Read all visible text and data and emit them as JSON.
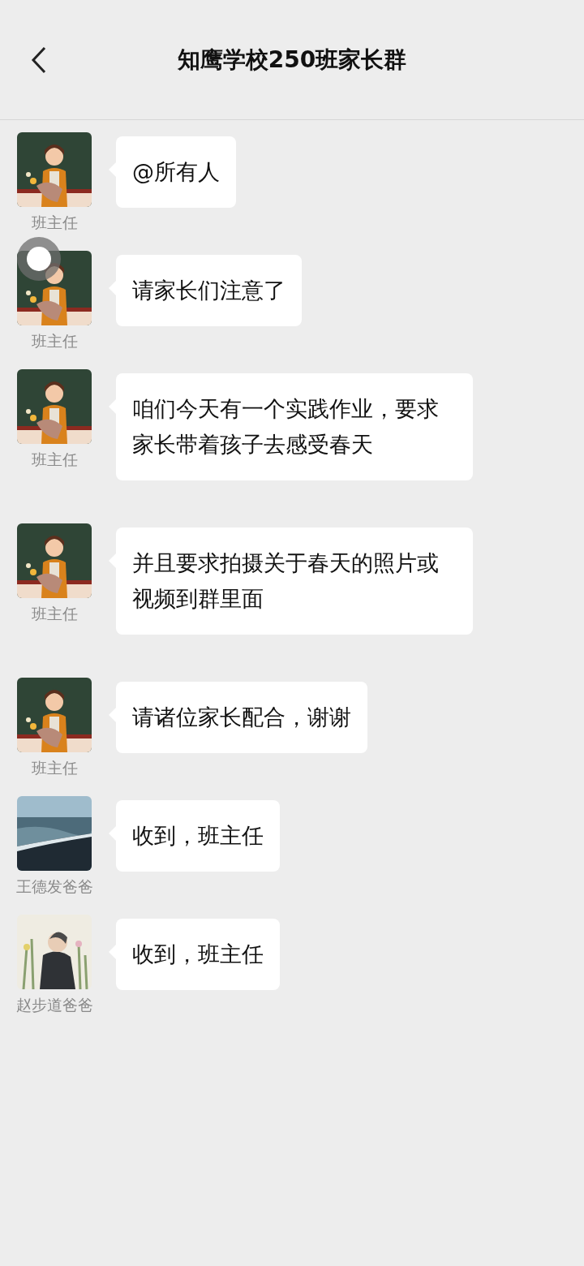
{
  "header": {
    "title": "知鹰学校250班家长群"
  },
  "messages": [
    {
      "sender": "班主任",
      "text": "@所有人"
    },
    {
      "sender": "班主任",
      "text": "请家长们注意了"
    },
    {
      "sender": "班主任",
      "text": "咱们今天有一个实践作业，要求家长带着孩子去感受春天"
    },
    {
      "sender": "班主任",
      "text": "并且要求拍摄关于春天的照片或视频到群里面"
    },
    {
      "sender": "班主任",
      "text": "请诸位家长配合，谢谢"
    },
    {
      "sender": "王德发爸爸",
      "text": "收到，班主任"
    },
    {
      "sender": "赵步道爸爸",
      "text": "收到，班主任"
    }
  ]
}
